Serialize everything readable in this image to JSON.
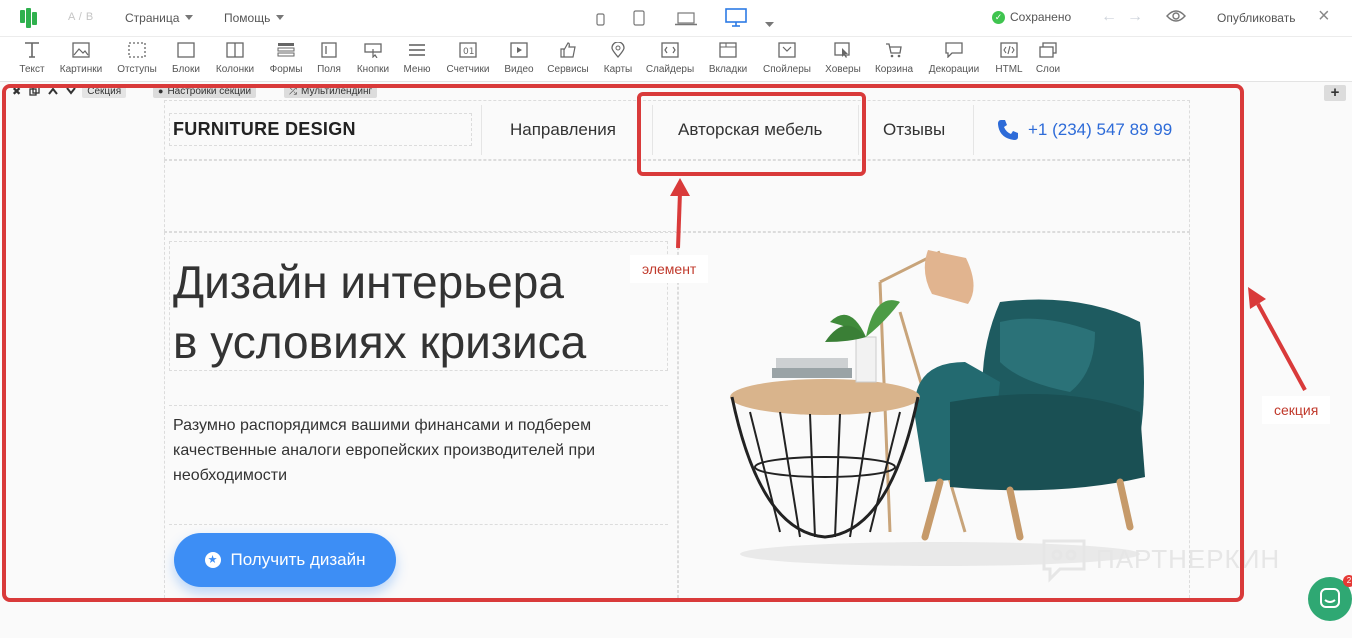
{
  "topbar": {
    "ab_label": "A / B",
    "menu_page": "Страница",
    "menu_help": "Помощь",
    "saved_label": "Сохранено",
    "publish_label": "Опубликовать",
    "active_device": "desktop",
    "accent_color": "#2d7be5",
    "saved_color": "#3fc44f"
  },
  "toolbar": {
    "tools": [
      "Текст",
      "Картинки",
      "Отступы",
      "Блоки",
      "Колонки",
      "Формы",
      "Поля",
      "Кнопки",
      "Меню",
      "Счетчики",
      "Видео",
      "Сервисы",
      "Карты",
      "Слайдеры",
      "Вкладки",
      "Спойлеры",
      "Ховеры",
      "Корзина",
      "Декорации",
      "HTML",
      "Слои"
    ]
  },
  "section_bar": {
    "section_label": "Секция",
    "settings_label": "Настройки секции",
    "multilanding_label": "Мультилендинг"
  },
  "site": {
    "logo": "FURNITURE DESIGN",
    "nav": [
      "Направления",
      "Авторская мебель",
      "Отзывы"
    ],
    "phone": "+1 (234) 547 89 99",
    "hero_title_line1": "Дизайн интерьера",
    "hero_title_line2": "в условиях кризиса",
    "hero_text": "Разумно распорядимся вашими финансами и подберем качественные аналоги европейских производителей при необходимости",
    "cta_label": "Получить дизайн",
    "cta_color": "#3d8ef5"
  },
  "annotations": {
    "element_label": "элемент",
    "section_label": "секция",
    "highlight_color": "#d93a3a"
  },
  "watermark": "ПАРТНЕРКИН",
  "chat_badge": "2"
}
